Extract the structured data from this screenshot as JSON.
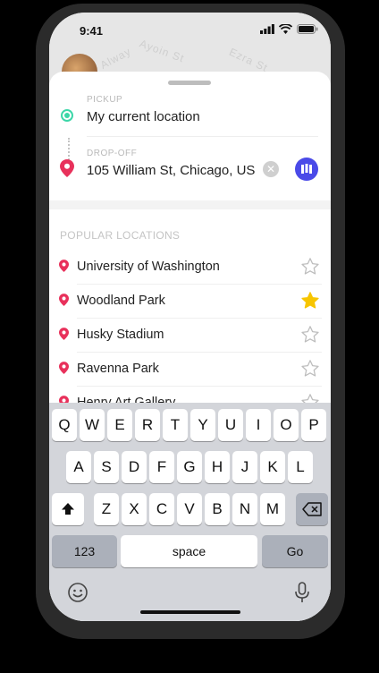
{
  "status_bar": {
    "time": "9:41"
  },
  "map": {
    "road_labels": [
      "Alway",
      "Ayoin St",
      "Ezra St"
    ]
  },
  "route": {
    "pickup_label": "PICKUP",
    "pickup_value": "My current location",
    "dropoff_label": "DROP-OFF",
    "dropoff_value": "105 William St, Chicago, US",
    "clear_glyph": "✕"
  },
  "popular": {
    "title": "POPULAR LOCATIONS",
    "items": [
      {
        "name": "University of Washington",
        "favorite": false
      },
      {
        "name": "Woodland Park",
        "favorite": true
      },
      {
        "name": "Husky Stadium",
        "favorite": false
      },
      {
        "name": "Ravenna Park",
        "favorite": false
      },
      {
        "name": "Henry Art Gallery",
        "favorite": false
      }
    ]
  },
  "keyboard": {
    "row1": [
      "Q",
      "W",
      "E",
      "R",
      "T",
      "Y",
      "U",
      "I",
      "O",
      "P"
    ],
    "row2": [
      "A",
      "S",
      "D",
      "F",
      "G",
      "H",
      "J",
      "K",
      "L"
    ],
    "row3": [
      "Z",
      "X",
      "C",
      "V",
      "B",
      "N",
      "M"
    ],
    "numbers_label": "123",
    "space_label": "space",
    "go_label": "Go"
  },
  "colors": {
    "accent": "#4a4ae8",
    "pickup": "#3dd6a8",
    "pin": "#e8315b",
    "star": "#f7c500"
  }
}
